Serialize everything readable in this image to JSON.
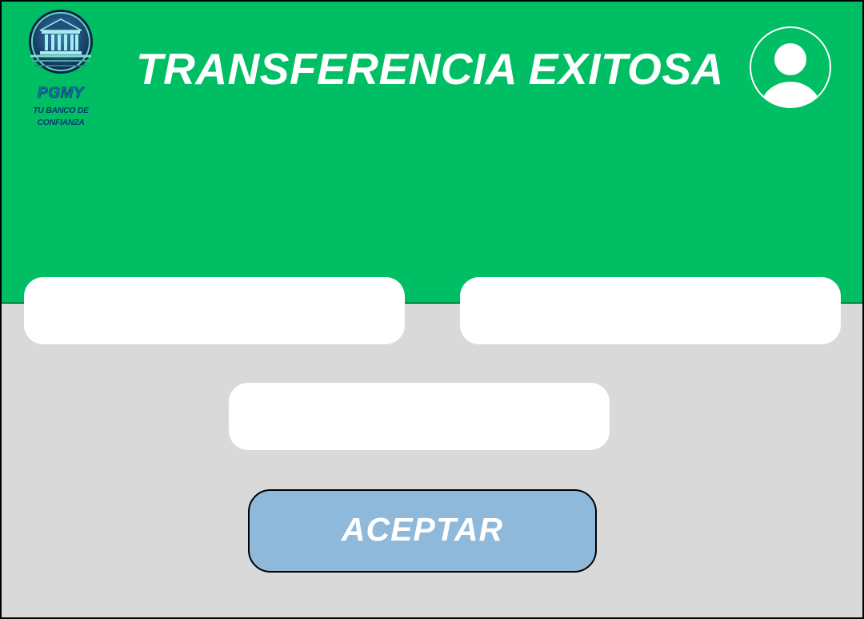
{
  "header": {
    "title": "TRANSFERENCIA EXITOSA",
    "background_color": "#00be64"
  },
  "logo": {
    "icon": "bank-building-icon",
    "name": "PGMY",
    "tagline": "TU BANCO DE CONFIANZA"
  },
  "user": {
    "icon": "user-avatar-icon"
  },
  "fields": [
    {
      "value": "",
      "placeholder": ""
    },
    {
      "value": "",
      "placeholder": ""
    },
    {
      "value": "",
      "placeholder": ""
    }
  ],
  "actions": {
    "accept_label": "ACEPTAR",
    "accept_color": "#8fb9db"
  },
  "body": {
    "background_color": "#d9d9d9"
  }
}
